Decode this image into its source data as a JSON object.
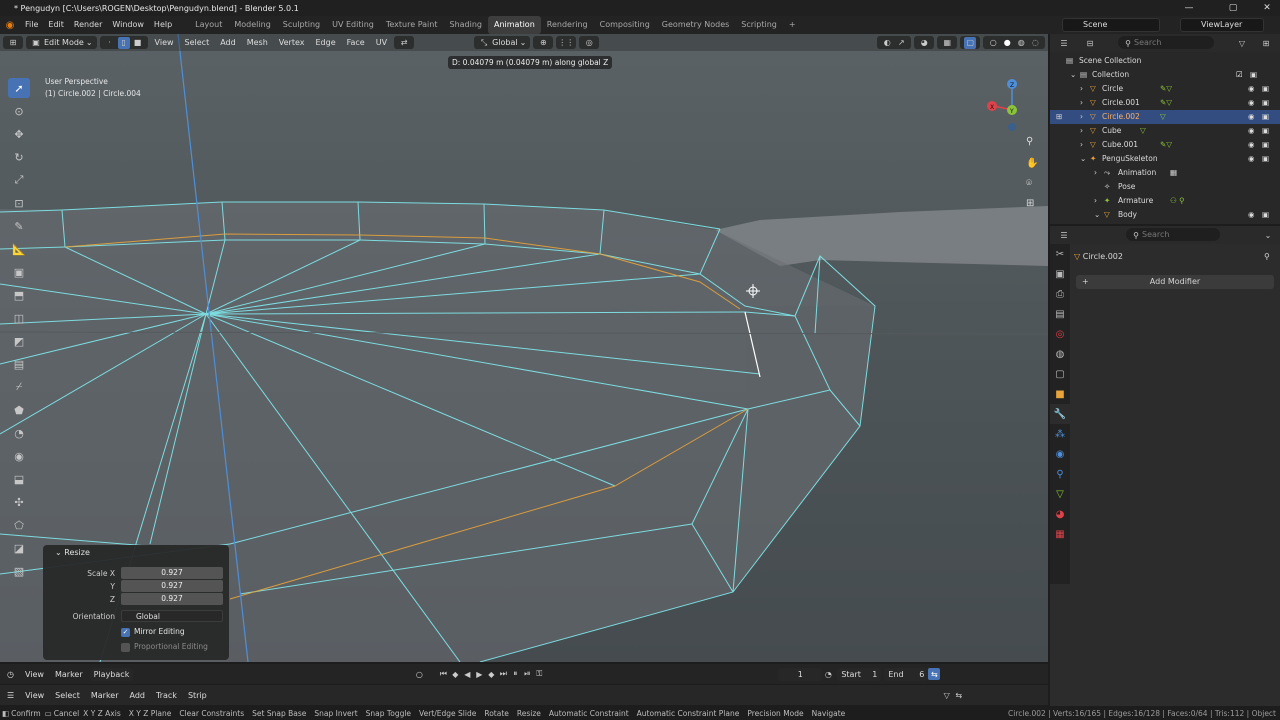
{
  "window": {
    "title": "* Pengudyn [C:\\Users\\ROGEN\\Desktop\\Pengudyn.blend] - Blender 5.0.1",
    "controls": [
      "—",
      "▢",
      "✕"
    ]
  },
  "menu": [
    "File",
    "Edit",
    "Render",
    "Window",
    "Help"
  ],
  "workspaces": [
    "Layout",
    "Modeling",
    "Sculpting",
    "UV Editing",
    "Texture Paint",
    "Shading",
    "Animation",
    "Rendering",
    "Compositing",
    "Geometry Nodes",
    "Scripting"
  ],
  "active_workspace": "Animation",
  "scene": {
    "label": "Scene",
    "view_layer": "ViewLayer"
  },
  "viewport_header": {
    "mode": "Edit Mode",
    "menus": [
      "View",
      "Select",
      "Add",
      "Mesh",
      "Vertex",
      "Edge",
      "Face",
      "UV"
    ],
    "orientation": "Global"
  },
  "viewport": {
    "perspective": "User Perspective",
    "object_info": "(1) Circle.002 | Circle.004",
    "operator_message": "D: 0.04079 m (0.04079 m) along global Z"
  },
  "gizmo": {
    "x": "X",
    "y": "Y",
    "z": "Z"
  },
  "resize_panel": {
    "title": "Resize",
    "scale_x_label": "Scale X",
    "y_label": "Y",
    "z_label": "Z",
    "scale_x": "0.927",
    "scale_y": "0.927",
    "scale_z": "0.927",
    "orientation_label": "Orientation",
    "orientation": "Global",
    "mirror_editing": "Mirror Editing",
    "proportional_editing": "Proportional Editing"
  },
  "timeline": {
    "menus": [
      "View",
      "Marker",
      "Playback"
    ],
    "current_frame": "1",
    "start_label": "Start",
    "start": "1",
    "end_label": "End",
    "end": "6"
  },
  "dopesheet": {
    "menus": [
      "View",
      "Select",
      "Marker",
      "Add",
      "Track",
      "Strip"
    ]
  },
  "status": [
    "Confirm",
    "Cancel",
    "X Y Z Axis",
    "X Y Z Plane",
    "Clear Constraints",
    "Set Snap Base",
    "Snap Invert",
    "Snap Toggle",
    "Vert/Edge Slide",
    "Rotate",
    "Resize",
    "Automatic Constraint",
    "Automatic Constraint Plane",
    "Precision Mode",
    "Navigate"
  ],
  "status_stats": "Circle.002 | Verts:16/165 | Edges:16/128 | Faces:0/64 | Tris:112 | Object",
  "outliner": {
    "search_placeholder": "Search",
    "scene_collection": "Scene Collection",
    "collection": "Collection",
    "items": [
      "Circle",
      "Circle.001",
      "Circle.002",
      "Cube",
      "Cube.001",
      "PenguSkeleton",
      "Animation",
      "Pose",
      "Armature",
      "Body"
    ]
  },
  "properties": {
    "search_placeholder": "Search",
    "object_name": "Circle.002",
    "add_modifier": "Add Modifier"
  },
  "colors": {
    "accent": "#4772b3",
    "wire": "#7fe3e6",
    "orange": "#e8a33a",
    "selection": "#334d80"
  }
}
